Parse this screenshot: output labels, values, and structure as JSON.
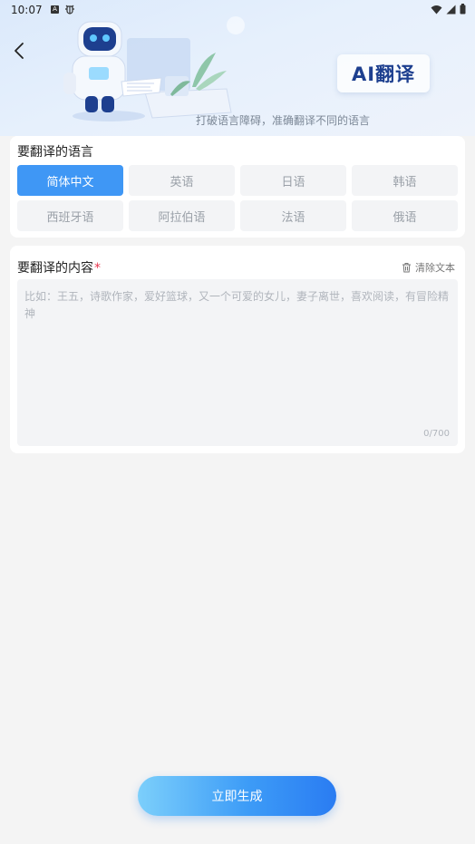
{
  "status_bar": {
    "time": "10:07",
    "left_icons": [
      "notification-a-icon",
      "bug-icon"
    ],
    "right_icons": [
      "wifi-icon",
      "signal-icon",
      "battery-icon"
    ]
  },
  "header": {
    "badge_text": "AI翻译",
    "subtitle": "打破语言障碍，准确翻译不同的语言"
  },
  "language_section": {
    "title": "要翻译的语言",
    "selected": "简体中文",
    "options": [
      "简体中文",
      "英语",
      "日语",
      "韩语",
      "西班牙语",
      "阿拉伯语",
      "法语",
      "俄语"
    ]
  },
  "content_section": {
    "title": "要翻译的内容",
    "required_mark": "*",
    "clear_label": "清除文本",
    "input_value": "",
    "placeholder": "比如：王五，诗歌作家，爱好篮球，又一个可爱的女儿，妻子离世，喜欢阅读，有冒险精神",
    "char_count": "0/700"
  },
  "footer": {
    "generate_label": "立即生成"
  },
  "colors": {
    "accent": "#3f97f5",
    "badge_text": "#1d3f8f",
    "required": "#e8374f"
  }
}
